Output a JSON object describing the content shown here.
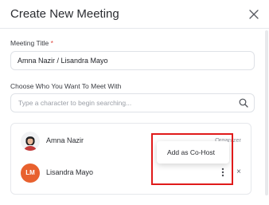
{
  "modal": {
    "title": "Create New Meeting"
  },
  "meeting_title": {
    "label": "Meeting Title",
    "required_mark": "*",
    "value": "Amna Nazir / Lisandra Mayo"
  },
  "participants_search": {
    "label": "Choose Who You Want To Meet With",
    "placeholder": "Type a character to begin searching..."
  },
  "participants": [
    {
      "name": "Amna Nazir",
      "role": "Organizer",
      "avatar": "photo"
    },
    {
      "name": "Lisandra Mayo",
      "initials": "LM",
      "avatar_color": "#e8612e",
      "remove": "×"
    }
  ],
  "context_menu": {
    "items": [
      "Add as Co-Host"
    ]
  },
  "colors": {
    "highlight": "#e01a1a",
    "required": "#e0463b",
    "avatar_lm": "#e8612e"
  },
  "icons": {
    "close": "close-icon",
    "search": "search-icon",
    "kebab": "kebab-menu-icon"
  }
}
